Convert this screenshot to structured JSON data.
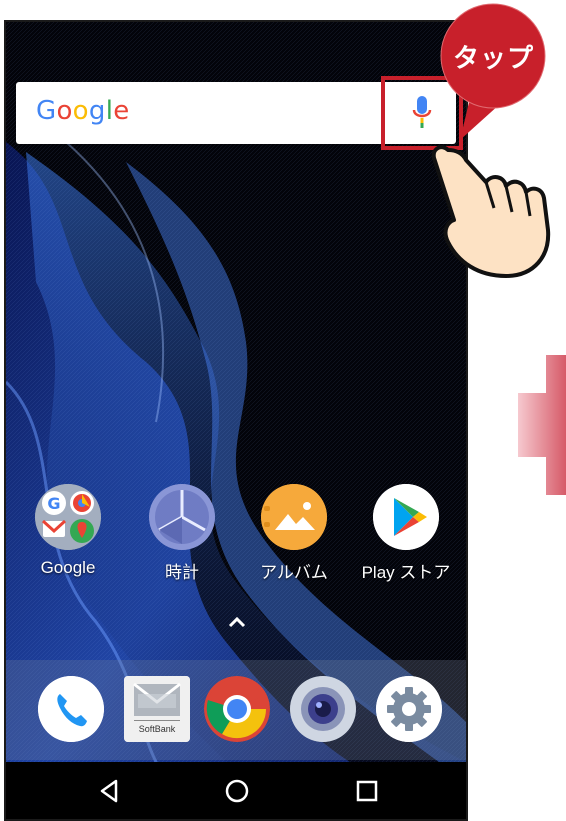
{
  "search_bar": {
    "logo_text": "Google",
    "logo_colors": [
      "#4285F4",
      "#EA4335",
      "#FBBC05",
      "#4285F4",
      "#34A853",
      "#EA4335"
    ],
    "mic_icon": "microphone-icon"
  },
  "callout": {
    "text": "タップ",
    "color": "#c8202b"
  },
  "apps": [
    {
      "label": "Google",
      "icon": "google-folder-icon"
    },
    {
      "label": "時計",
      "icon": "clock-icon"
    },
    {
      "label": "アルバム",
      "icon": "album-icon"
    },
    {
      "label": "Play ストア",
      "icon": "play-store-icon"
    }
  ],
  "dock": [
    {
      "icon": "phone-icon"
    },
    {
      "icon": "softbank-mail-icon",
      "label": "SoftBank"
    },
    {
      "icon": "chrome-icon"
    },
    {
      "icon": "camera-icon"
    },
    {
      "icon": "settings-icon"
    }
  ],
  "navbar": [
    "back-icon",
    "home-icon",
    "recents-icon"
  ]
}
